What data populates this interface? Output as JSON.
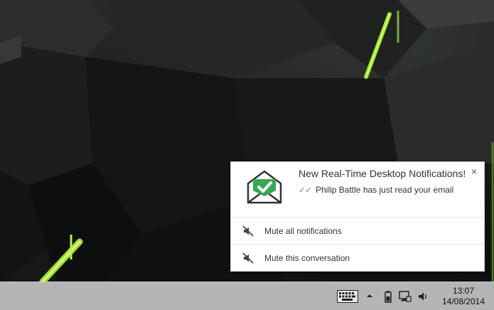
{
  "notification": {
    "title": "New Real-Time Desktop Notifications!",
    "read_ticks": "✓✓",
    "message": "Philip Battle has just read your email",
    "close_glyph": "×",
    "actions": [
      {
        "label": "Mute all notifications",
        "icon": "mute-icon"
      },
      {
        "label": "Mute this conversation",
        "icon": "mute-icon"
      }
    ],
    "logo_icon": "envelope-check-icon",
    "accent": "#35a853"
  },
  "taskbar": {
    "tray_icons": [
      "keyboard-icon",
      "chevron-up-icon",
      "power-icon",
      "network-icon",
      "volume-icon"
    ],
    "time": "13:07",
    "date": "14/08/2014"
  },
  "wallpaper": {
    "colors": {
      "base": "#1a1c1c",
      "glow": "#9be02a"
    }
  }
}
